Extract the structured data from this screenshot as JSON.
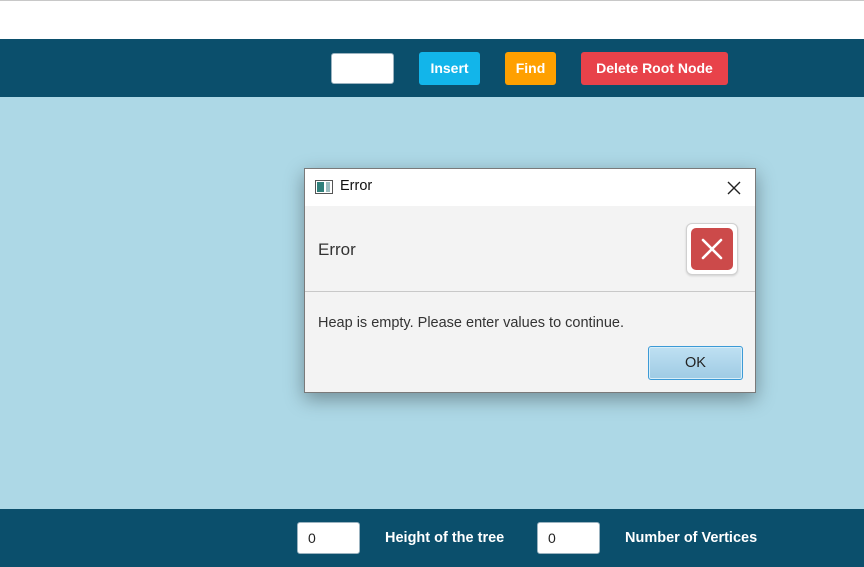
{
  "toolbar": {
    "value_input": "",
    "insert_label": "Insert",
    "find_label": "Find",
    "delete_label": "Delete Root Node",
    "colors": {
      "bar": "#0b4f6c",
      "insert": "#12b5ea",
      "find": "#ffa000",
      "delete": "#e8424a"
    }
  },
  "canvas": {
    "background": "#add8e6"
  },
  "status_bar": {
    "height_value": "0",
    "height_label": "Height of the tree",
    "vertices_value": "0",
    "vertices_label": "Number of Vertices"
  },
  "dialog": {
    "title": "Error",
    "header": "Error",
    "content": "Heap is empty. Please enter values to continue.",
    "ok_label": "OK",
    "icons": {
      "app": "window-app-icon",
      "close": "close-icon",
      "error": "error-x-icon"
    },
    "error_color": "#cc4a4a"
  }
}
